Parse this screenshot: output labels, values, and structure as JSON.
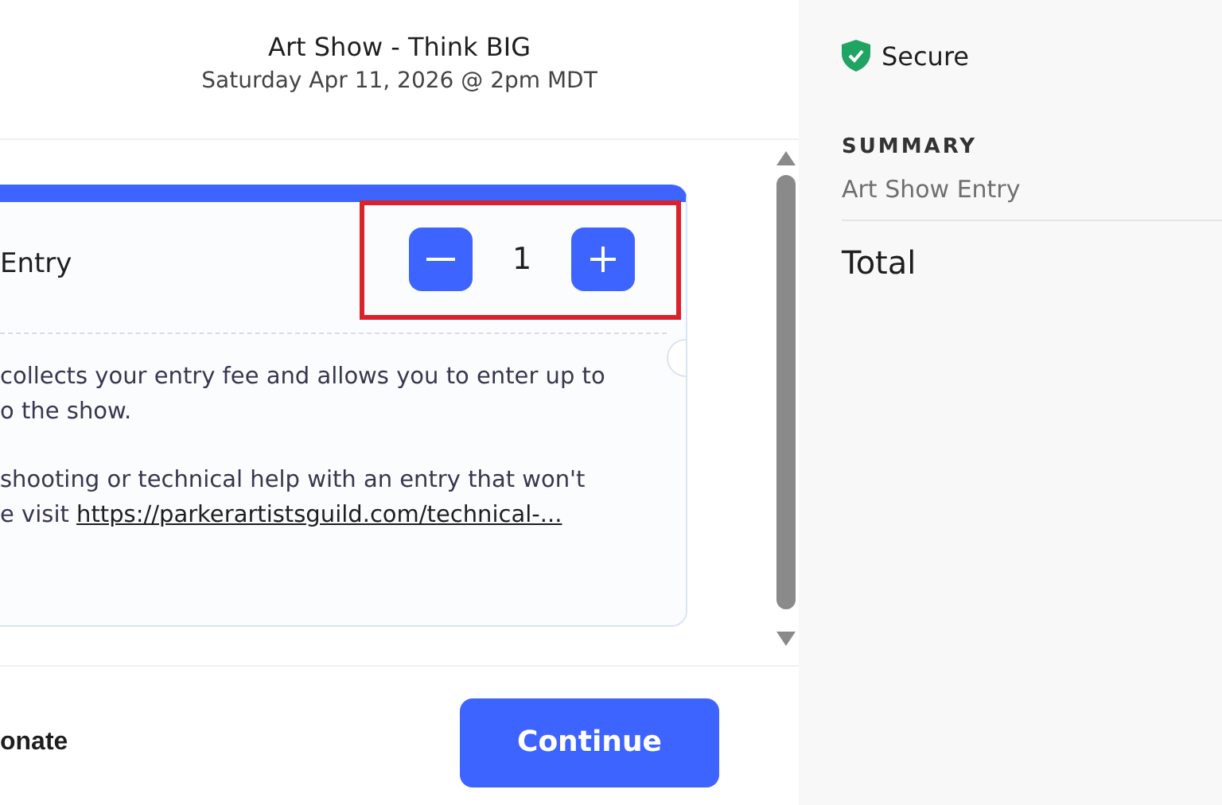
{
  "header": {
    "title": "Art Show - Think BIG",
    "subtitle": "Saturday Apr 11, 2026 @ 2pm MDT"
  },
  "ticket": {
    "name": "Entry",
    "quantity": "1",
    "highlighted": true,
    "description": [
      [
        "collects your entry fee and allows you to enter up to",
        "o the show."
      ],
      [
        "shooting or technical help with an entry that won't"
      ]
    ],
    "link_prefix": "e visit ",
    "link": "https://parkerartistsguild.com/technical-..."
  },
  "footer": {
    "secondary": "onate",
    "primary": "Continue"
  },
  "sidebar": {
    "secure": "Secure",
    "summary_heading": "SUMMARY",
    "summary_item": "Art Show Entry",
    "total_label": "Total"
  }
}
